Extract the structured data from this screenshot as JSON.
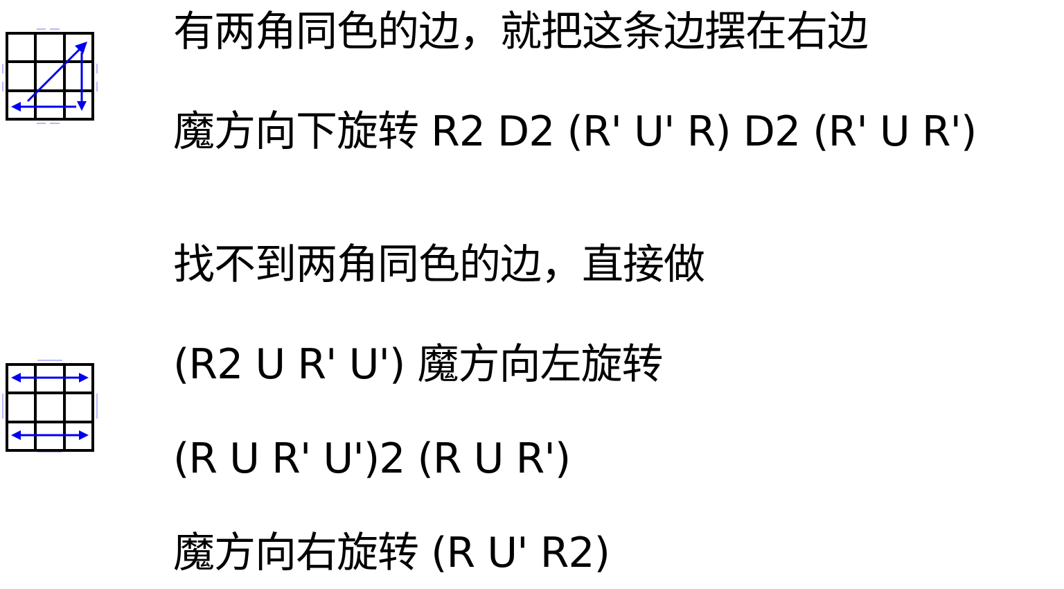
{
  "sections": [
    {
      "diagram": "edge-corners-diagonal-swap-diagram",
      "lines": [
        "有两角同色的边，就把这条边摆在右边",
        "魔方向下旋转 R2 D2 (R' U' R) D2 (R' U R')"
      ]
    },
    {
      "diagram": "two-edge-swap-diagram",
      "lines": [
        "找不到两角同色的边，直接做",
        "(R2 U R' U') 魔方向左旋转",
        "(R U R' U')2 (R U R')",
        "魔方向右旋转 (R U' R2)"
      ]
    }
  ],
  "colors": {
    "text": "#000000",
    "grid": "#000000",
    "arrow": "#0000ee",
    "background": "#ffffff"
  }
}
